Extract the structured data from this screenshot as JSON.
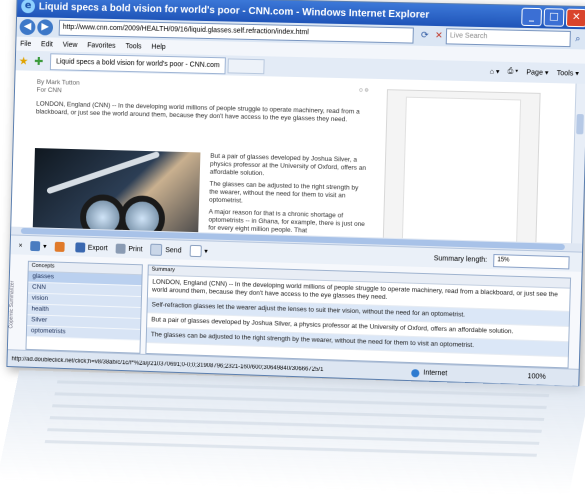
{
  "window": {
    "title": "Liquid specs a bold vision for world's poor - CNN.com - Windows Internet Explorer",
    "minimize": "_",
    "maximize": "□",
    "close": "✕"
  },
  "address": {
    "url": "http://www.cnn.com/2009/HEALTH/09/16/liquid.glasses.self.refraction/index.html",
    "search_placeholder": "Live Search",
    "back": "◀",
    "forward": "▶"
  },
  "menu": [
    "File",
    "Edit",
    "View",
    "Favorites",
    "Tools",
    "Help"
  ],
  "tab": {
    "label": "Liquid specs a bold vision for world's poor - CNN.com",
    "tools": [
      "Page ▾",
      "Tools ▾"
    ]
  },
  "article": {
    "byline1": "By Mark Tutton",
    "byline2": "For CNN",
    "lead": "LONDON, England (CNN) -- In the developing world millions of people struggle to operate machinery, read from a blackboard, or just see the world around them, because they don't have access to the eye glasses they need.",
    "side_paragraphs": [
      "But a pair of glasses developed by Joshua Silver, a physics professor at the University of Oxford, offers an affordable solution.",
      "The glasses can be adjusted to the right strength by the wearer, without the need for them to visit an optometrist.",
      "A major reason for that is a chronic shortage of optometrists -- in Ghana, for example, there is just one for every eight million people. That"
    ]
  },
  "summarizer": {
    "close": "×",
    "export": "Export",
    "print": "Print",
    "send": "Send",
    "length_label": "Summary length:",
    "length_value": "15%",
    "side_label": "Copernic Summarizer",
    "concepts_header": "Concepts",
    "summary_header": "Summary",
    "concepts": [
      "glasses",
      "CNN",
      "vision",
      "health",
      "Silver",
      "optometrists"
    ],
    "sentences": [
      "LONDON, England (CNN) -- In the developing world millions of people struggle to operate machinery, read from a blackboard, or just see the world around them, because they don't have access to the eye glasses they need.",
      "Self-refraction glasses let the wearer adjust the lenses to suit their vision, without the need for an optometrist.",
      "But a pair of glasses developed by Joshua Silver, a physics professor at the University of Oxford, offers an affordable solution.",
      "The glasses can be adjusted to the right strength by the wearer, without the need for them to visit an optometrist."
    ]
  },
  "status": {
    "url": "http://ad.doubleclick.net/click;h=v8/38ab/c/1c/f*%2a/j/210370691;0-0;0;31908796;2321-160/600;30649840/30666725/1",
    "zone": "Internet",
    "zoom": "100%"
  },
  "colors": {
    "titlebar": "#1f54b8",
    "highlight_row": "#dbe7f7",
    "concept_bg": "#d8e4f5"
  }
}
